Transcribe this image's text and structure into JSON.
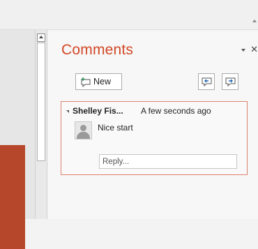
{
  "pane": {
    "title": "Comments",
    "new_button_label": "New"
  },
  "comment": {
    "author": "Shelley Fis...",
    "time": "A few seconds ago",
    "text": "Nice start",
    "reply_placeholder": "Reply..."
  },
  "icons": {
    "new_comment": "new-comment-icon",
    "previous_comment": "previous-comment-icon",
    "next_comment": "next-comment-icon",
    "collapse": "collapse-triangle-icon",
    "close": "close-icon",
    "options": "chevron-down-icon",
    "avatar": "avatar-icon"
  },
  "colors": {
    "accent": "#d24726",
    "card_border": "#d9826c",
    "slide_thumb": "#b7472a"
  }
}
